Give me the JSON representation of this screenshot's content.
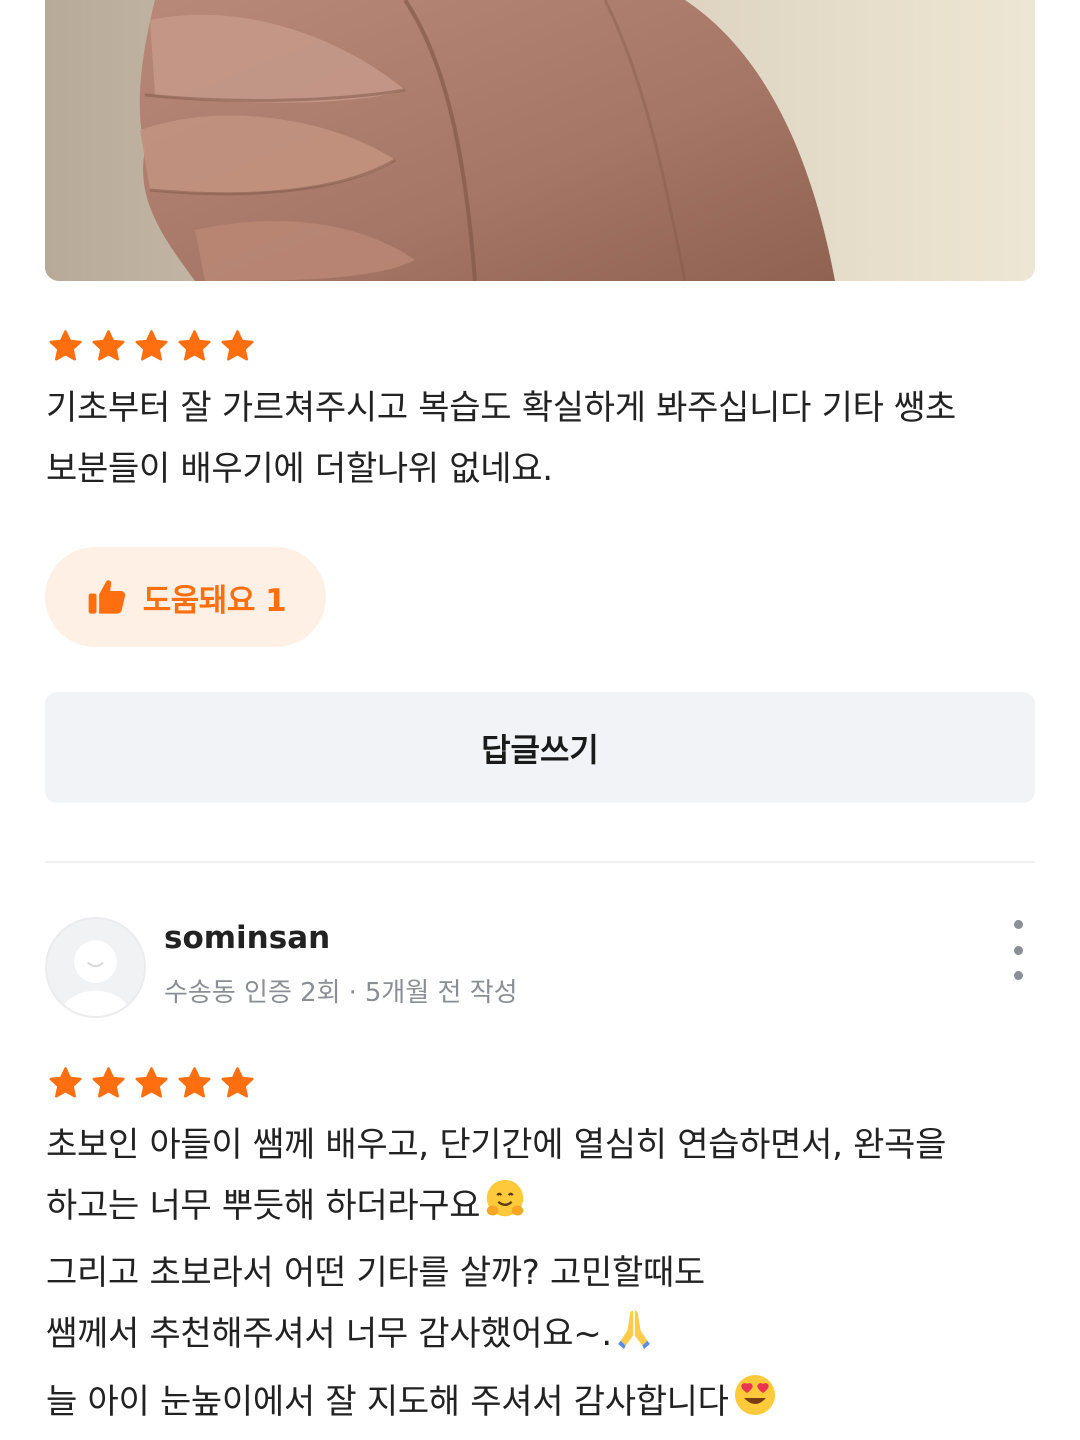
{
  "review1": {
    "rating": 5,
    "text_lines": [
      "기초부터 잘 가르쳐주시고 복습도 확실하게 봐주십니다 기타 쌩초",
      "보분들이 배우기에 더할나위 없네요."
    ],
    "helpful_label": "도움돼요 1",
    "reply_label": "답글쓰기"
  },
  "review2": {
    "author": "sominsan",
    "location_badge": "수송동 인증 2회",
    "separator": "·",
    "time": "5개월 전 작성",
    "rating": 5,
    "text_lines": [
      "초보인 아들이 쌤께 배우고, 단기간에 열심히 연습하면서, 완곡을",
      "하고는 너무 뿌듯해 하더라구요",
      "그리고 초보라서 어떤 기타를 살까? 고민할때도",
      "쌤께서 추천해주셔서 너무 감사했어요~.",
      "늘 아이 눈높이에서 잘 지도해 주셔서 감사합니다"
    ]
  },
  "colors": {
    "accent": "#ff6f0f",
    "helpful_bg": "#fff0e5",
    "reply_bg": "#f2f3f6",
    "meta_text": "#8b8e95"
  },
  "icons": {
    "star": "star-icon",
    "thumb": "thumbs-up-icon",
    "more": "more-vertical-icon",
    "avatar": "default-avatar-icon"
  }
}
